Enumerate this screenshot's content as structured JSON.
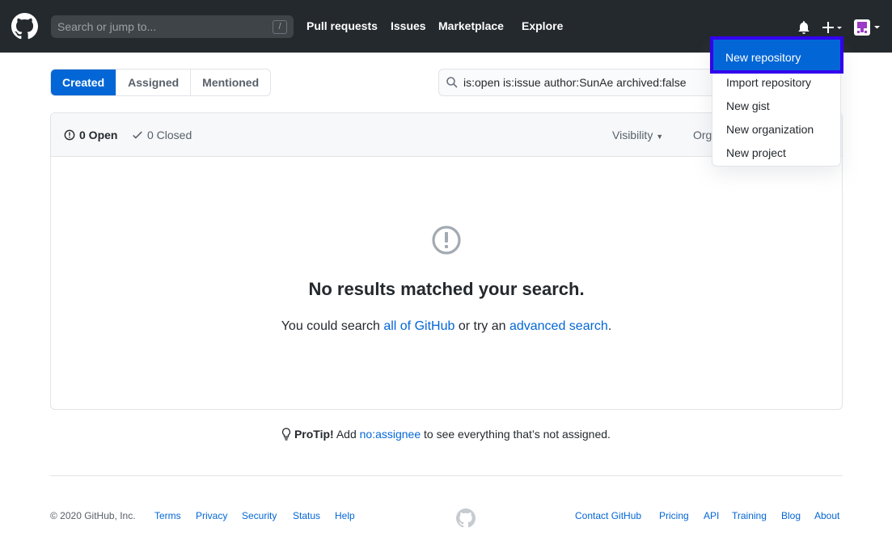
{
  "header": {
    "search_placeholder": "Search or jump to...",
    "search_shortcut": "/",
    "nav": [
      "Pull requests",
      "Issues",
      "Marketplace",
      "Explore"
    ]
  },
  "tabs": [
    {
      "label": "Created",
      "active": true
    },
    {
      "label": "Assigned",
      "active": false
    },
    {
      "label": "Mentioned",
      "active": false
    }
  ],
  "filter": {
    "value": "is:open is:issue author:SunAe archived:false"
  },
  "box": {
    "open_label": "0 Open",
    "closed_label": "0 Closed",
    "visibility_label": "Visibility",
    "org_label": "Org"
  },
  "blank": {
    "title": "No results matched your search.",
    "text_before": "You could search ",
    "link1": "all of GitHub",
    "text_middle": " or try an ",
    "link2": "advanced search",
    "text_after": "."
  },
  "protip": {
    "label": "ProTip!",
    "before": " Add ",
    "link": "no:assignee",
    "after": " to see everything that’s not assigned."
  },
  "footer": {
    "copyright": "© 2020 GitHub, Inc.",
    "left_links": [
      "Terms",
      "Privacy",
      "Security",
      "Status",
      "Help"
    ],
    "right_links": [
      "Contact GitHub",
      "Pricing",
      "API",
      "Training",
      "Blog",
      "About"
    ]
  },
  "dropdown": {
    "items": [
      "New repository",
      "Import repository",
      "New gist",
      "New organization",
      "New project"
    ]
  },
  "colors": {
    "accent": "#0366d6",
    "highlight_border": "#3300ee",
    "header_bg": "#24292e"
  }
}
